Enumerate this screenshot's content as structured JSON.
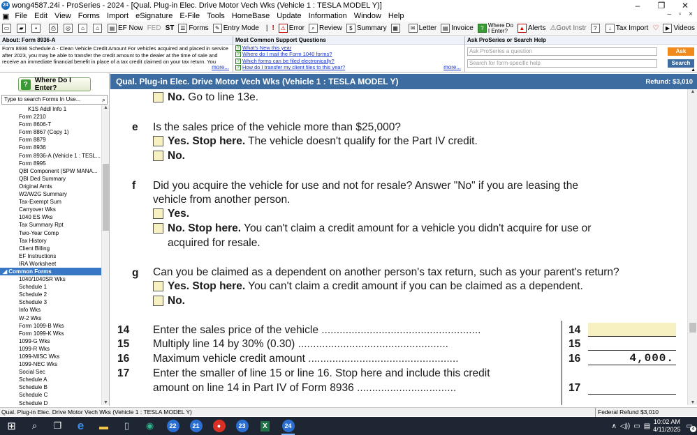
{
  "window": {
    "title": "wong4587.24i - ProSeries - 2024 - [Qual. Plug-in Elec. Drive Motor Vech Wks (Vehicle 1 : TESLA MODEL Y)]",
    "app_icon_text": "24",
    "minimize": "–",
    "restore": "❐",
    "close": "✕"
  },
  "menu": {
    "items": [
      "File",
      "Edit",
      "View",
      "Forms",
      "Import",
      "eSignature",
      "E-File",
      "Tools",
      "HomeBase",
      "Update",
      "Information",
      "Window",
      "Help"
    ],
    "mdi_controls": "– ▫ ×"
  },
  "toolbar": {
    "ef_now": "EF Now",
    "fed": "FED",
    "st": "ST",
    "forms": "Forms",
    "entry_mode": "Entry Mode",
    "error": "Error",
    "review": "Review",
    "summary": "Summary",
    "letter": "Letter",
    "invoice": "Invoice",
    "where_do_i_enter_line1": "Where Do",
    "where_do_i_enter_line2": "I Enter?",
    "alerts": "Alerts",
    "govt_instr": "Govt Instr",
    "tax_import": "Tax Import",
    "videos": "Videos"
  },
  "about": {
    "heading": "About: Form 8936-A",
    "text": "Form 8936 Schedule A - Clean Vehicle Credit Amount For vehicles acquired and placed in service after 2023, you may be able to transfer the credit amount to the dealer at the time of sale and receive an immediate financial benefit in place of a tax credit claimed on your tax return. You",
    "more": "more..."
  },
  "support": {
    "heading": "Most Common Support Questions",
    "links": [
      "What's New this year",
      "Where do I mail the Form 1040 forms?",
      "Which forms can be filed electronically?",
      "How do I transfer my client files to this year?"
    ],
    "more": "more..."
  },
  "ask": {
    "heading": "Ask ProSeries or Search Help",
    "ask_placeholder": "Ask ProSeries a question",
    "ask_button": "Ask",
    "search_placeholder": "Search for form-specific help",
    "search_button": "Search",
    "ask_color": "#f08a1c",
    "search_color": "#3d6da0"
  },
  "sidebar": {
    "where_do_i_enter": "Where Do I Enter?",
    "search_placeholder": "Type to search Forms In Use...",
    "forms_in_use": [
      "K1S Addl Info 1",
      "Form 2210",
      "Form 8606-T",
      "Form 8867 (Copy 1)",
      "Form 8879",
      "Form 8936",
      "Form 8936-A (Vehicle 1 : TESL...",
      "Form 8995",
      "QBI Component (SPW MANA...",
      "QBI Ded Summary",
      "Original Amts",
      "W2/W2G Summary",
      "Tax-Exempt Sum",
      "Carryover Wks",
      "1040 ES Wks",
      "Tax Summary Rpt",
      "Two-Year Comp",
      "Tax History",
      "Client Billing",
      "EF Instructions",
      "IRA Worksheet"
    ],
    "common_forms_header": "Common Forms",
    "common_forms": [
      "1040/1040SR Wks",
      "Schedule 1",
      "Schedule 2",
      "Schedule 3",
      "Info Wks",
      "W-2 Wks",
      "Form 1099-B Wks",
      "Form 1099-K Wks",
      "1099-G Wks",
      "1099-R Wks",
      "1099-MISC Wks",
      "1099-NEC Wks",
      "Social Sec",
      "Schedule A",
      "Schedule B",
      "Schedule C",
      "Schedule D"
    ]
  },
  "form_header": {
    "title": "Qual. Plug-in Elec. Drive Motor Vech Wks (Vehicle 1 : TESLA MODEL Y)",
    "refund": "Refund: $3,010"
  },
  "form": {
    "top_no": {
      "bold": "No.",
      "text": " Go to line 13e."
    },
    "e": {
      "letter": "e",
      "question": "Is the sales price of the vehicle more than $25,000?",
      "yes_bold": "Yes. Stop here.",
      "yes_text": " The vehicle doesn't qualify for the Part IV credit.",
      "no_bold": "No."
    },
    "f": {
      "letter": "f",
      "question_l1": "Did you acquire the vehicle for use and not for resale? Answer \"No\" if you are leasing the",
      "question_l2": "vehicle from another person.",
      "yes_bold": "Yes.",
      "no_bold": "No. Stop here.",
      "no_text_l1": " You can't claim a credit amount for a vehicle you didn't acquire for use or",
      "no_text_l2": "acquired for resale."
    },
    "g": {
      "letter": "g",
      "question": "Can you be claimed as a dependent on another person's tax return, such as your parent's return?",
      "yes_bold": "Yes. Stop here.",
      "yes_text": " You can't claim a credit amount if you can be claimed as a dependent.",
      "no_bold": "No."
    },
    "lines": [
      {
        "num": "14",
        "text": "Enter the sales price of the vehicle",
        "box": "14",
        "amount": ""
      },
      {
        "num": "15",
        "text": "Multiply line 14 by 30% (0.30)",
        "box": "15",
        "amount": ""
      },
      {
        "num": "16",
        "text": "Maximum vehicle credit amount",
        "box": "16",
        "amount": "4,000."
      },
      {
        "num": "17",
        "text": "Enter the smaller of line 15 or line 16. Stop here and include this credit",
        "text2": "amount on line 14 in Part IV of Form 8936",
        "box": "17",
        "amount": ""
      }
    ],
    "input_fill_color": "#f7f0c0"
  },
  "status": {
    "left": "Qual. Plug-in Elec. Drive Motor Vech Wks (Vehicle 1 : TESLA MODEL Y)",
    "right": "Federal Refund $3,010"
  },
  "taskbar": {
    "time": "10:02 AM",
    "date": "4/11/2025",
    "apps": [
      "22",
      "21",
      "23",
      "24"
    ],
    "notification_count": "4"
  }
}
